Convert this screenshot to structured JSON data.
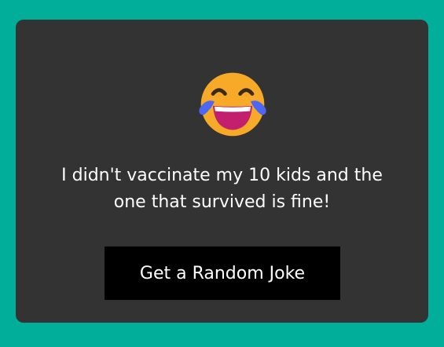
{
  "colors": {
    "page_background": "#00ae9a",
    "card_background": "#333333",
    "text": "#ffffff",
    "button_background": "#000000",
    "emoji_face": "#f7a928",
    "emoji_mouth": "#c2206f",
    "emoji_tears": "#4d67f5"
  },
  "emoji": {
    "icon": "face-with-tears-of-joy-icon"
  },
  "joke": {
    "text": "I didn't vaccinate my 10 kids and the one that survived is fine!"
  },
  "button": {
    "label": "Get a Random Joke"
  }
}
